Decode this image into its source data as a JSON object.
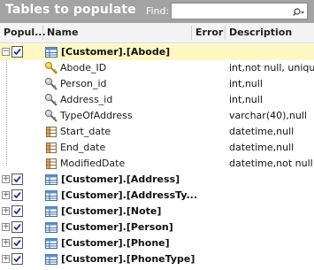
{
  "titlebar": {
    "title": "Tables to populate",
    "find_label": "Find:",
    "find_value": ""
  },
  "columns": {
    "populate": "Popul...",
    "name": "Name",
    "error": "Error",
    "description": "Description"
  },
  "selected_table": {
    "label": "[Customer].[Abode]",
    "expanded": true,
    "checked": true,
    "columns": [
      {
        "name": "Abode_ID",
        "icon": "primary-key-icon",
        "description": "int,not null, unique"
      },
      {
        "name": "Person_id",
        "icon": "foreign-key-icon",
        "description": "int,null"
      },
      {
        "name": "Address_id",
        "icon": "foreign-key-icon",
        "description": "int,null"
      },
      {
        "name": "TypeOfAddress",
        "icon": "foreign-key-icon",
        "description": "varchar(40),null"
      },
      {
        "name": "Start_date",
        "icon": "column-icon",
        "description": "datetime,null"
      },
      {
        "name": "End_date",
        "icon": "column-icon",
        "description": "datetime,null"
      },
      {
        "name": "ModifiedDate",
        "icon": "column-icon",
        "description": "datetime,not null"
      }
    ]
  },
  "other_tables": [
    {
      "label": "[Customer].[Address]",
      "checked": true
    },
    {
      "label": "[Customer].[AddressTy...",
      "checked": true
    },
    {
      "label": "[Customer].[Note]",
      "checked": true
    },
    {
      "label": "[Customer].[Person]",
      "checked": true
    },
    {
      "label": "[Customer].[Phone]",
      "checked": true
    },
    {
      "label": "[Customer].[PhoneType]",
      "checked": true
    }
  ],
  "colors": {
    "titlebar": "#a3a3a3",
    "selected_row": "#fff7c2",
    "header": "#f4f4f4"
  }
}
